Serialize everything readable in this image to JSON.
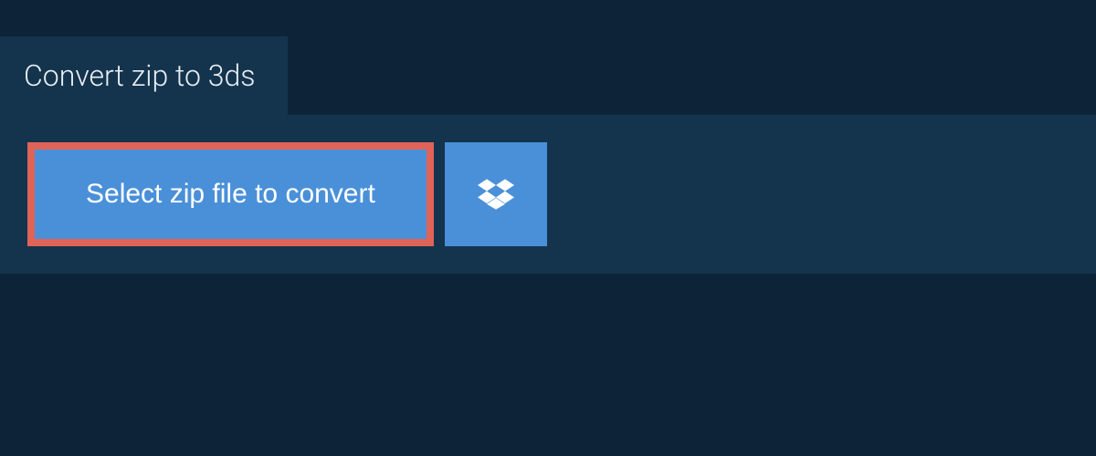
{
  "header": {
    "title": "Convert zip to 3ds"
  },
  "actions": {
    "select_label": "Select zip file to convert",
    "dropbox_icon": "dropbox"
  }
}
